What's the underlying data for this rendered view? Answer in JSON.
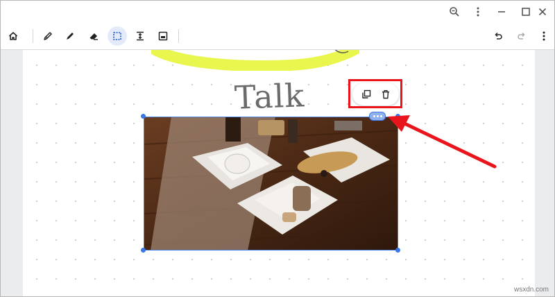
{
  "window": {
    "controls": [
      "zoom-icon",
      "more-vert-icon",
      "minimize-icon",
      "maximize-icon",
      "close-icon"
    ]
  },
  "toolbar": {
    "left_tools": [
      "home-icon",
      "pen-icon",
      "marker-icon",
      "eraser-icon",
      "select-icon",
      "spacing-icon",
      "image-icon"
    ],
    "active_tool": "select-icon",
    "right_tools": [
      "undo-icon",
      "redo-icon",
      "more-vert-icon"
    ]
  },
  "canvas": {
    "handwritten_text": "Talk",
    "highlight_color": "#e5f53a",
    "selection_color": "#3b78e7"
  },
  "context_menu": {
    "actions": [
      "duplicate-icon",
      "delete-icon"
    ]
  },
  "annotation": {
    "color": "#e8151d"
  },
  "watermark": "wsxdn.com"
}
